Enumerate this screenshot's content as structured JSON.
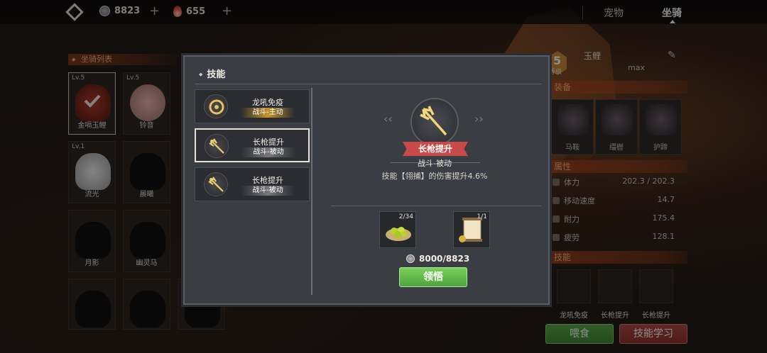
{
  "top": {
    "currency1_value": "8823",
    "currency2_value": "655",
    "tabs": [
      "宠物",
      "坐骑"
    ],
    "active_tab": "坐骑"
  },
  "left": {
    "section_title": "坐骑列表",
    "mounts": [
      {
        "level": "Lv.5",
        "name": "金嗝玉鲤",
        "selected": true
      },
      {
        "level": "Lv.5",
        "name": "铃音",
        "selected": false
      },
      {
        "level": "Lv.1",
        "name": "流光",
        "selected": false
      },
      {
        "level": "",
        "name": "晨曦",
        "selected": false
      },
      {
        "level": "",
        "name": "月影",
        "selected": false
      },
      {
        "level": "",
        "name": "幽灵马",
        "selected": false
      },
      {
        "level": "",
        "name": "",
        "selected": false
      },
      {
        "level": "",
        "name": "",
        "selected": false
      }
    ]
  },
  "right": {
    "level_value": "5",
    "level_label": "等级",
    "mount_name": "玉鲤",
    "level_max": "max",
    "equip_title": "装备",
    "equips": [
      "马鞍",
      "缰辔",
      "护蹄"
    ],
    "attr_title": "属性",
    "stats": [
      {
        "label": "体力",
        "value": "202.3 / 202.3"
      },
      {
        "label": "移动速度",
        "value": "14.7"
      },
      {
        "label": "耐力",
        "value": "175.4"
      },
      {
        "label": "疲劳",
        "value": "128.1"
      }
    ],
    "skill_title": "技能",
    "skills": [
      "龙吼免疫",
      "长枪提升",
      "长枪提升"
    ],
    "feed_button": "喂食",
    "learn_button": "技能学习"
  },
  "modal": {
    "title": "技能",
    "skills": [
      {
        "name": "龙吼免疫",
        "type": "战斗-主动",
        "selected": false,
        "style": "gold"
      },
      {
        "name": "长枪提升",
        "type": "战斗-被动",
        "selected": true,
        "style": "gray"
      },
      {
        "name": "长枪提升",
        "type": "战斗-被动",
        "selected": false,
        "style": "gray"
      }
    ],
    "detail": {
      "name": "长枪提升",
      "type": "战斗-被动",
      "description": "技能【翎捕】的伤害提升4.6%"
    },
    "materials": [
      {
        "count": "2/34",
        "icon": "green-fruit-plate-icon"
      },
      {
        "count": "1/1",
        "icon": "scroll-icon"
      }
    ],
    "cost": "8000/8823",
    "learn_button": "领悟"
  },
  "colors": {
    "accent_orange": "#f0b47a",
    "green_button": "#5aa84a",
    "red_button": "#b04a44",
    "ribbon_red": "#c94a4a"
  }
}
